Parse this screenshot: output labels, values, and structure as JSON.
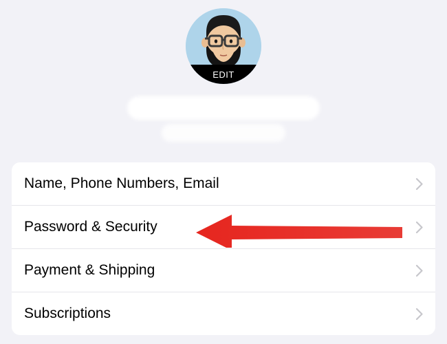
{
  "profile": {
    "edit_label": "EDIT"
  },
  "settings_list": {
    "items": [
      {
        "label": "Name, Phone Numbers, Email"
      },
      {
        "label": "Password & Security"
      },
      {
        "label": "Payment & Shipping"
      },
      {
        "label": "Subscriptions"
      }
    ]
  },
  "annotation": {
    "arrow_color": "#e6261f",
    "target_item_index": 1
  }
}
